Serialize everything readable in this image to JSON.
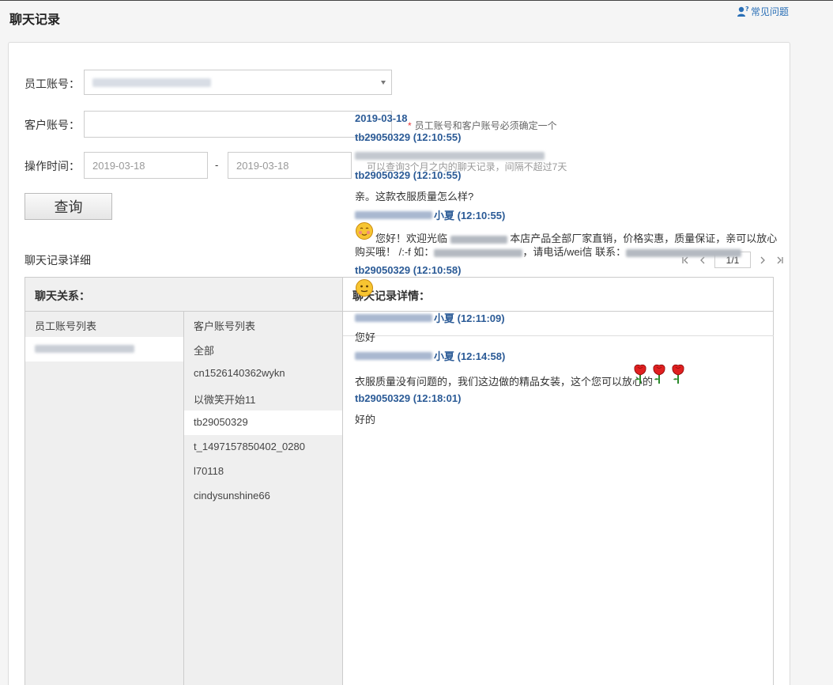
{
  "page": {
    "title": "聊天记录",
    "faq_label": "常见问题"
  },
  "form": {
    "staff_label": "员工账号：",
    "customer_label": "客户账号：",
    "customer_value": "",
    "required_note": "员工账号和客户账号必须确定一个",
    "time_label": "操作时间：",
    "date_from": "2019-03-18",
    "date_separator": "-",
    "date_to": "2019-03-18",
    "time_hint": "可以查询3个月之内的聊天记录，间隔不超过7天",
    "query_button": "查询"
  },
  "detail": {
    "section_title": "聊天记录详细",
    "pager": {
      "first": "|<",
      "prev": "<",
      "page": "1/1",
      "next": ">",
      "last": ">|"
    },
    "relation_header": "聊天关系：",
    "detail_header": "聊天记录详情：",
    "staff_list_header": "员工账号列表",
    "customer_list_header": "客户账号列表",
    "customers": [
      "全部",
      "cn1526140362wykn",
      "以微笑开始11",
      "tb29050329",
      "t_1497157850402_0280",
      "l70118",
      "cindysunshine66"
    ],
    "selected_customer": "tb29050329"
  },
  "messages": {
    "date": "2019-03-18",
    "m1_sender": "tb29050329 (12:10:55)",
    "m2_sender": "tb29050329 (12:10:55)",
    "m2_text": "亲。这款衣服质量怎么样?",
    "m3_sender": "小夏 (12:10:55)",
    "m3_text_a": "您好！欢迎光临",
    "m3_text_b": "本店产品全部厂家直销，价格实惠，质量保证，亲可以放心",
    "m3_text_c": "购买哦！ /:-f 如：",
    "m3_text_d": "，请电话/wei信 联系：",
    "m4_sender": "tb29050329 (12:10:58)",
    "m5_sender": "小夏 (12:11:09)",
    "m5_text": "您好",
    "m6_sender": "小夏 (12:14:58)",
    "m6_text": "衣服质量没有问题的，我们这边做的精品女装，这个您可以放心的",
    "m7_sender": "tb29050329 (12:18:01)",
    "m7_text": "好的"
  },
  "colors": {
    "link": "#2a6fb6",
    "sender": "#2a5a96",
    "required": "#e4393c"
  }
}
